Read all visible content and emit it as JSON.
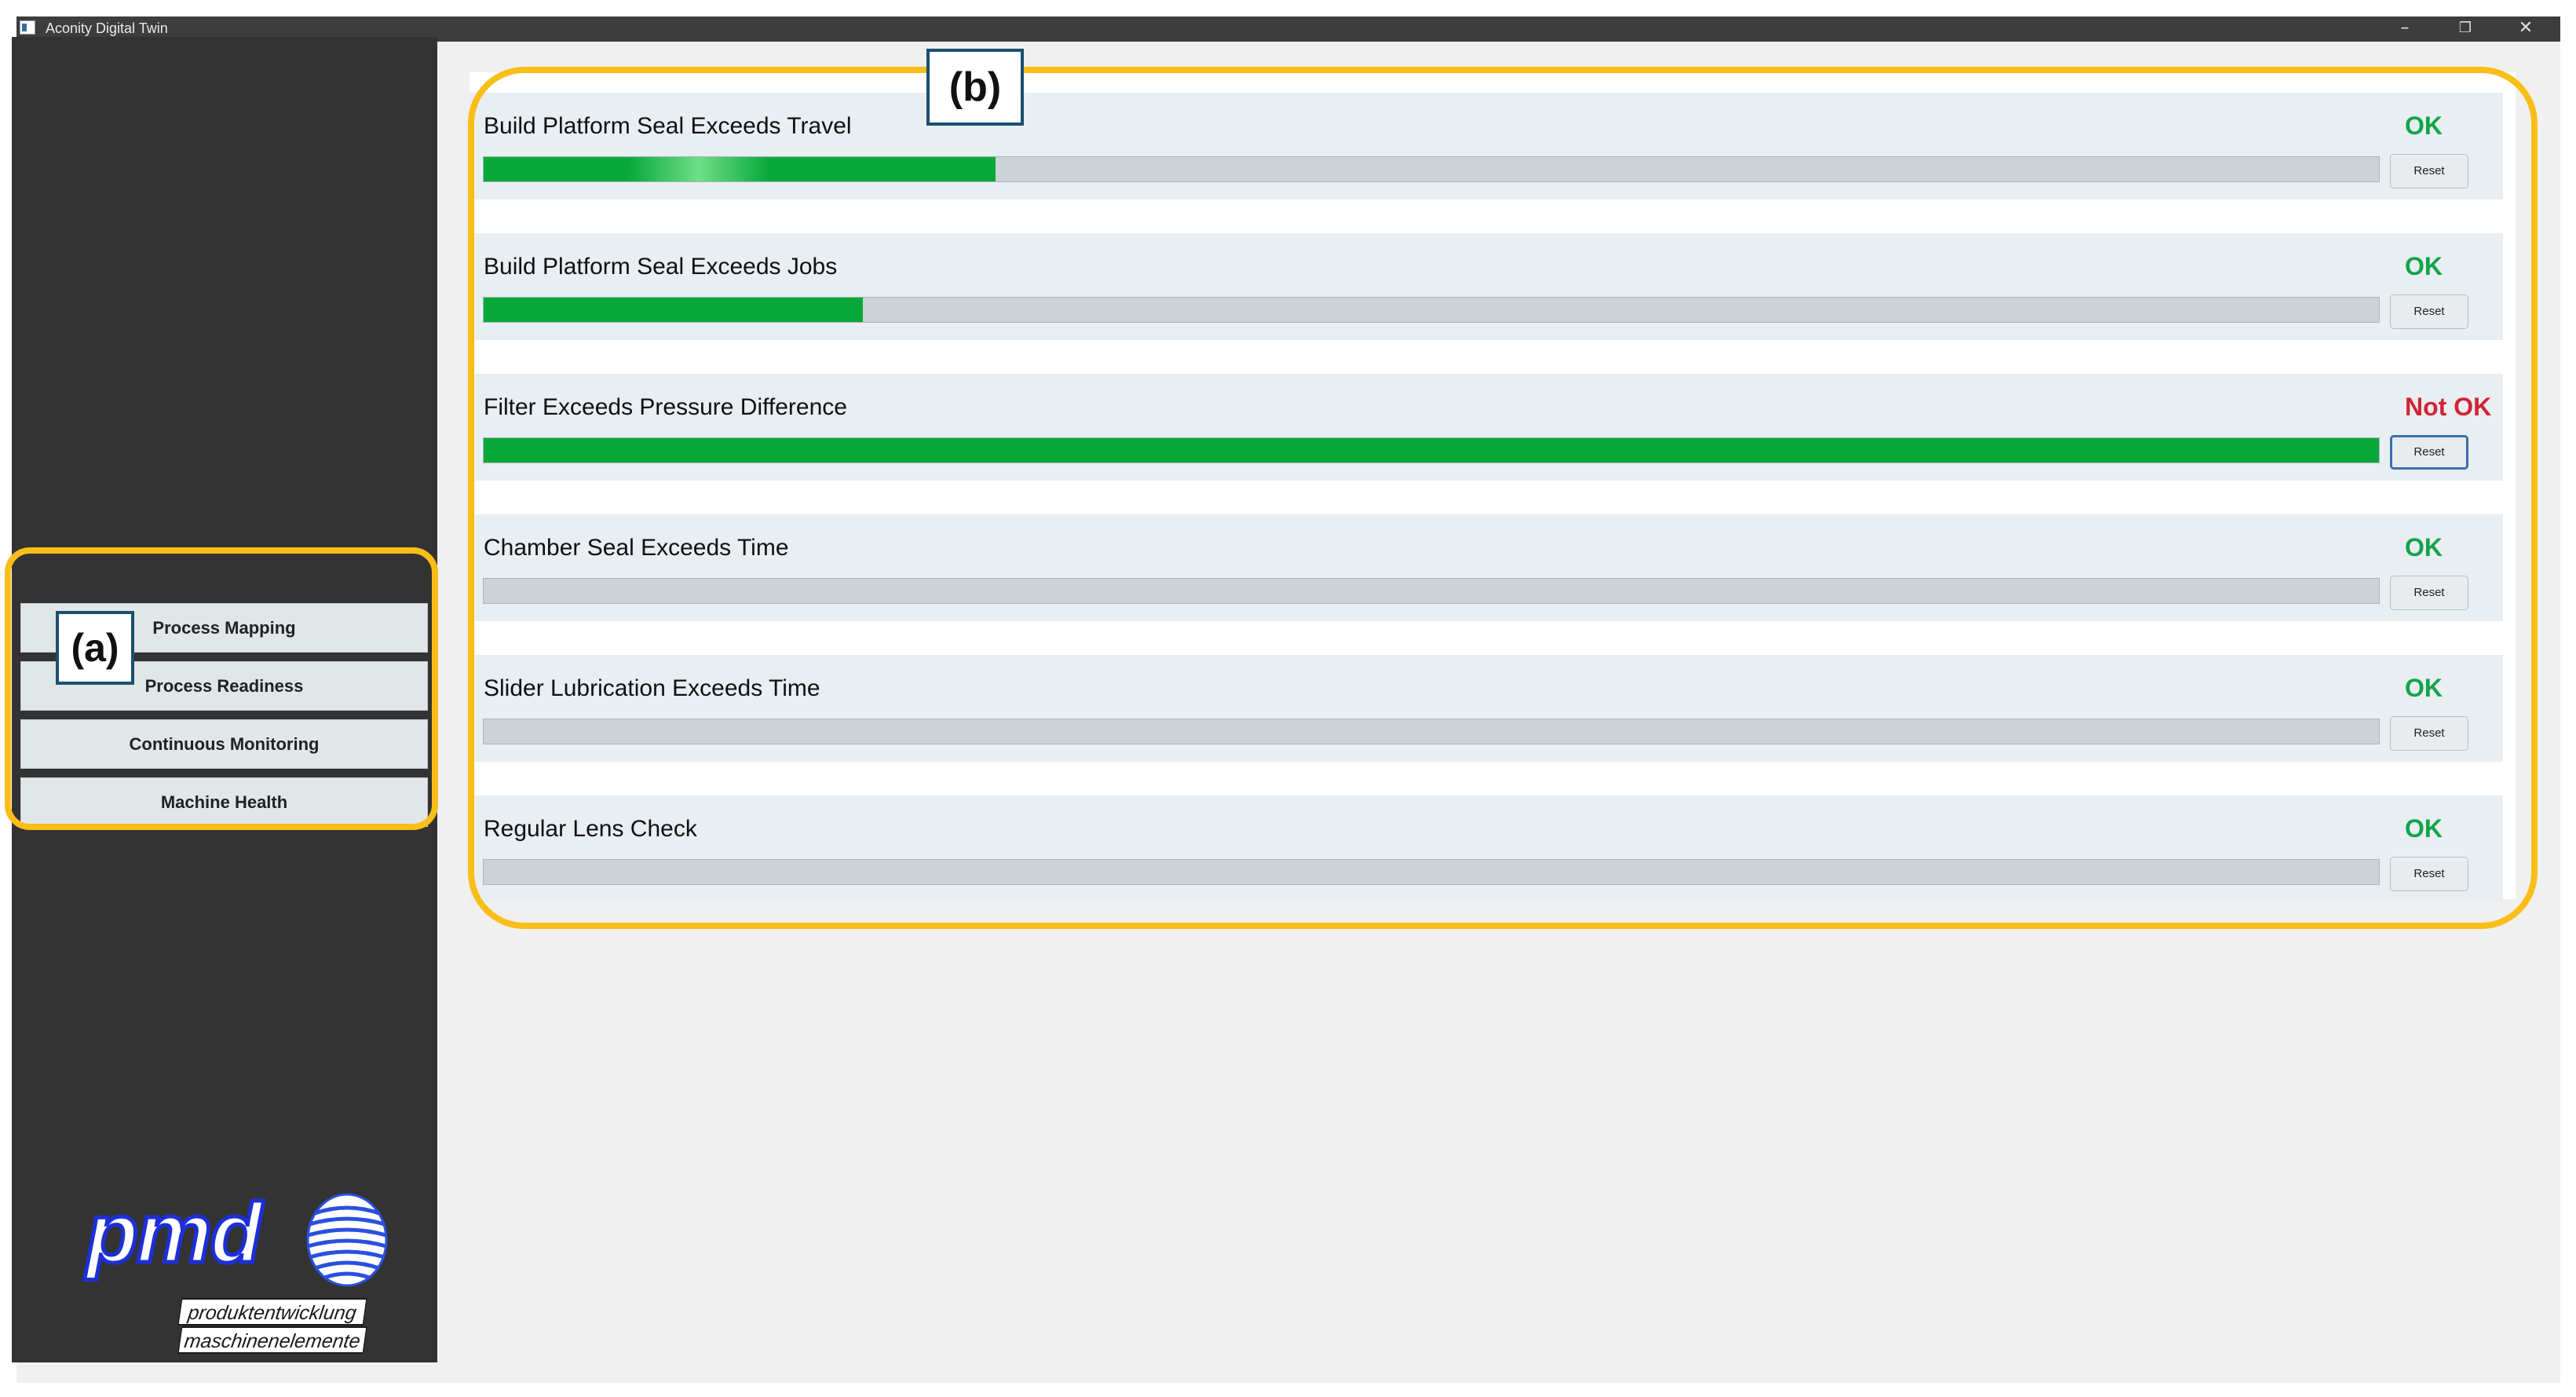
{
  "window": {
    "title": "Aconity Digital Twin",
    "controls": [
      "–",
      "❐",
      "✕"
    ]
  },
  "sidebar": {
    "nav": [
      {
        "label": "Process Mapping"
      },
      {
        "label": "Process Readiness"
      },
      {
        "label": "Continuous Monitoring"
      },
      {
        "label": "Machine Health"
      }
    ],
    "logo": {
      "word": "pmd",
      "tagline": [
        "produktentwicklung",
        "maschinenelemente"
      ]
    }
  },
  "annotations": {
    "a": "(a)",
    "b": "(b)"
  },
  "monitors": [
    {
      "label": "Build Platform Seal Exceeds Travel",
      "status": "OK",
      "progress": 0.27,
      "reset_label": "Reset"
    },
    {
      "label": "Build Platform Seal Exceeds Jobs",
      "status": "OK",
      "progress": 0.2,
      "reset_label": "Reset"
    },
    {
      "label": "Filter Exceeds Pressure Difference",
      "status": "Not OK",
      "progress": 1.0,
      "reset_label": "Reset"
    },
    {
      "label": "Chamber Seal Exceeds Time",
      "status": "OK",
      "progress": 0.0,
      "reset_label": "Reset"
    },
    {
      "label": "Slider Lubrication Exceeds Time",
      "status": "OK",
      "progress": 0.0,
      "reset_label": "Reset"
    },
    {
      "label": "Regular Lens Check",
      "status": "OK",
      "progress": 0.0,
      "reset_label": "Reset"
    }
  ],
  "colors": {
    "ok": "#12a44a",
    "not_ok": "#d12335",
    "bar_fill": "#06a83a",
    "highlight": "#f9be18"
  }
}
